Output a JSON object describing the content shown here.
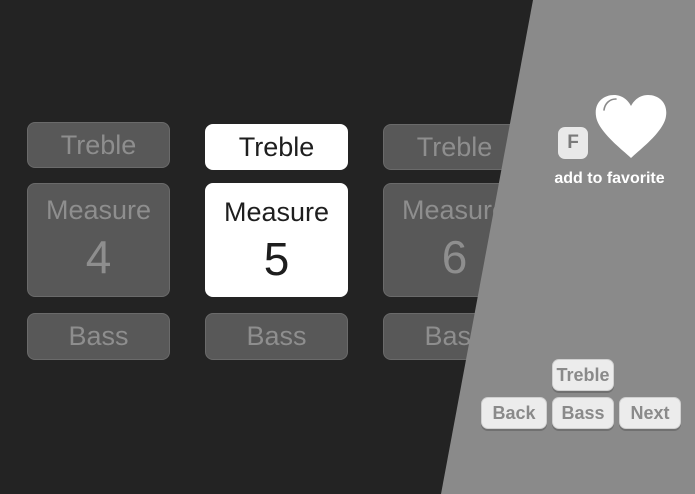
{
  "measures": [
    {
      "treble": "Treble",
      "label": "Measure",
      "number": "4",
      "bass": "Bass",
      "active": false
    },
    {
      "treble": "Treble",
      "label": "Measure",
      "number": "5",
      "bass": "Bass",
      "active": true
    },
    {
      "treble": "Treble",
      "label": "Measure",
      "number": "6",
      "bass": "Bass",
      "active": false
    }
  ],
  "favorite": {
    "key_badge": "F",
    "label": "add to favorite",
    "icon": "heart-icon"
  },
  "nav": {
    "treble": "Treble",
    "back": "Back",
    "bass": "Bass",
    "next": "Next"
  },
  "colors": {
    "background": "#232323",
    "panel": "#8a8a8a",
    "inactive_button": "#585858",
    "active_button": "#ffffff"
  }
}
